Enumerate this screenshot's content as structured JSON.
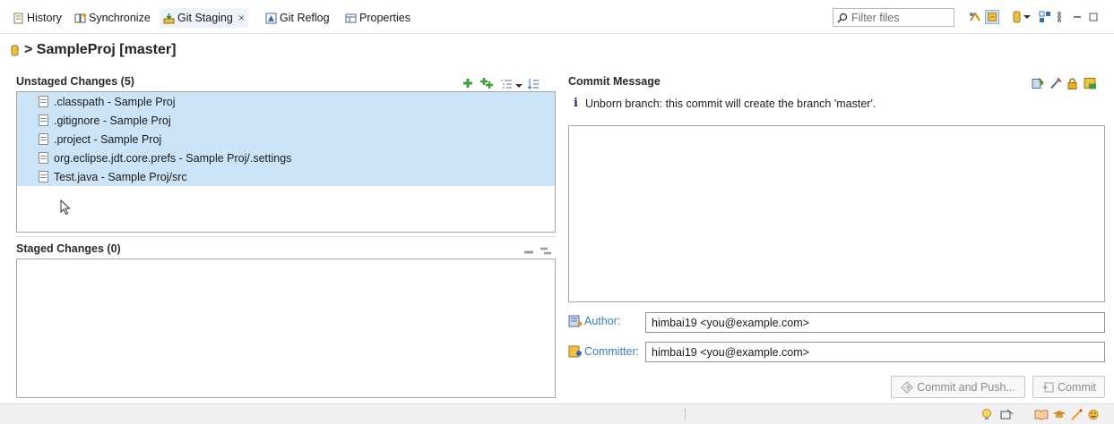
{
  "tabs": [
    {
      "label": "History",
      "icon": "history-icon"
    },
    {
      "label": "Synchronize",
      "icon": "synchronize-icon"
    },
    {
      "label": "Git Staging",
      "icon": "git-staging-icon",
      "close": "×"
    },
    {
      "label": "Git Reflog",
      "icon": "git-reflog-icon"
    },
    {
      "label": "Properties",
      "icon": "properties-icon"
    }
  ],
  "filter": {
    "placeholder": "Filter files"
  },
  "repo": {
    "title": "> SampleProj [master]"
  },
  "unstaged": {
    "title": "Unstaged Changes (5)",
    "files": [
      ".classpath - Sample Proj",
      ".gitignore - Sample Proj",
      ".project - Sample Proj",
      "org.eclipse.jdt.core.prefs - Sample Proj/.settings",
      "Test.java - Sample Proj/src"
    ]
  },
  "staged": {
    "title": "Staged Changes (0)"
  },
  "commit": {
    "title": "Commit Message",
    "info": "Unborn branch: this commit will create the branch 'master'.",
    "author_label": "Author:",
    "author_value": "himbai19 <you@example.com>",
    "committer_label": "Committer:",
    "committer_value": "himbai19 <you@example.com>",
    "commit_push_label": "Commit and Push...",
    "commit_label": "Commit"
  },
  "colors": {
    "selection": "#cce4f7",
    "link": "#3a7fc4"
  }
}
